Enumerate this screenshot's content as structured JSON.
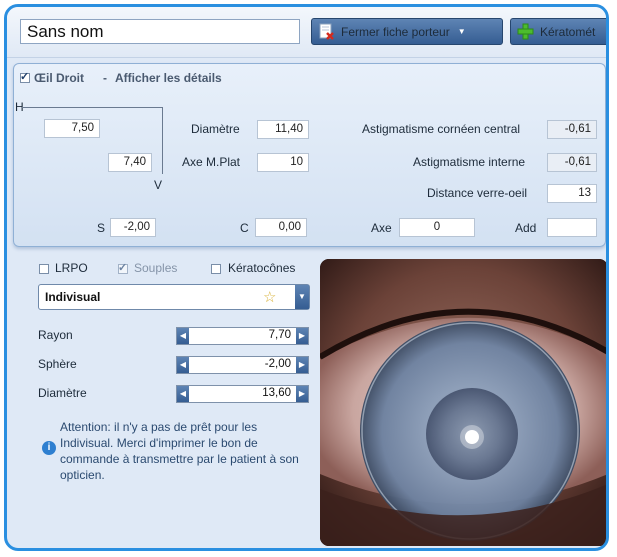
{
  "header": {
    "title_value": "Sans nom",
    "close_button_label": "Fermer fiche porteur",
    "keratometry_button_label": "Kératomét"
  },
  "eye_panel": {
    "checkbox_checked": true,
    "eye_label": "Œil Droit",
    "separator": "-",
    "details_link": "Afficher les détails",
    "h_label": "H",
    "v_label": "V",
    "h_value": "7,50",
    "v_value": "7,40",
    "diametre_label": "Diamètre",
    "diametre_value": "11,40",
    "axe_mplat_label": "Axe M.Plat",
    "axe_mplat_value": "10",
    "astig_corneen_label": "Astigmatisme cornéen central",
    "astig_corneen_value": "-0,61",
    "astig_interne_label": "Astigmatisme interne",
    "astig_interne_value": "-0,61",
    "distance_label": "Distance verre-oeil",
    "distance_value": "13",
    "s_label": "S",
    "s_value": "-2,00",
    "c_label": "C",
    "c_value": "0,00",
    "axe_label": "Axe",
    "axe_value": "0",
    "add_label": "Add",
    "add_value": ""
  },
  "lens_panel": {
    "filters": [
      {
        "label": "LRPO",
        "checked": false,
        "disabled": false
      },
      {
        "label": "Souples",
        "checked": true,
        "disabled": true
      },
      {
        "label": "Kératocônes",
        "checked": false,
        "disabled": false
      }
    ],
    "selected_lens": "Indivisual",
    "params": [
      {
        "label": "Rayon",
        "value": "7,70"
      },
      {
        "label": "Sphère",
        "value": "-2,00"
      },
      {
        "label": "Diamètre",
        "value": "13,60"
      }
    ],
    "info_text": "Attention: il n'y a pas de prêt pour les Indivisual. Merci d'imprimer le bon de commande à transmettre par le patient à son opticien."
  },
  "colors": {
    "frame_border": "#2a8fe0",
    "button_blue": "#4a72a6",
    "panel_bg": "#dfe9f6",
    "info_icon": "#2e7fd0"
  },
  "icons": {
    "close_sheet": "document-red-x-icon",
    "keratometry": "green-plus-icon",
    "favorite": "star-icon",
    "info": "info-icon"
  }
}
